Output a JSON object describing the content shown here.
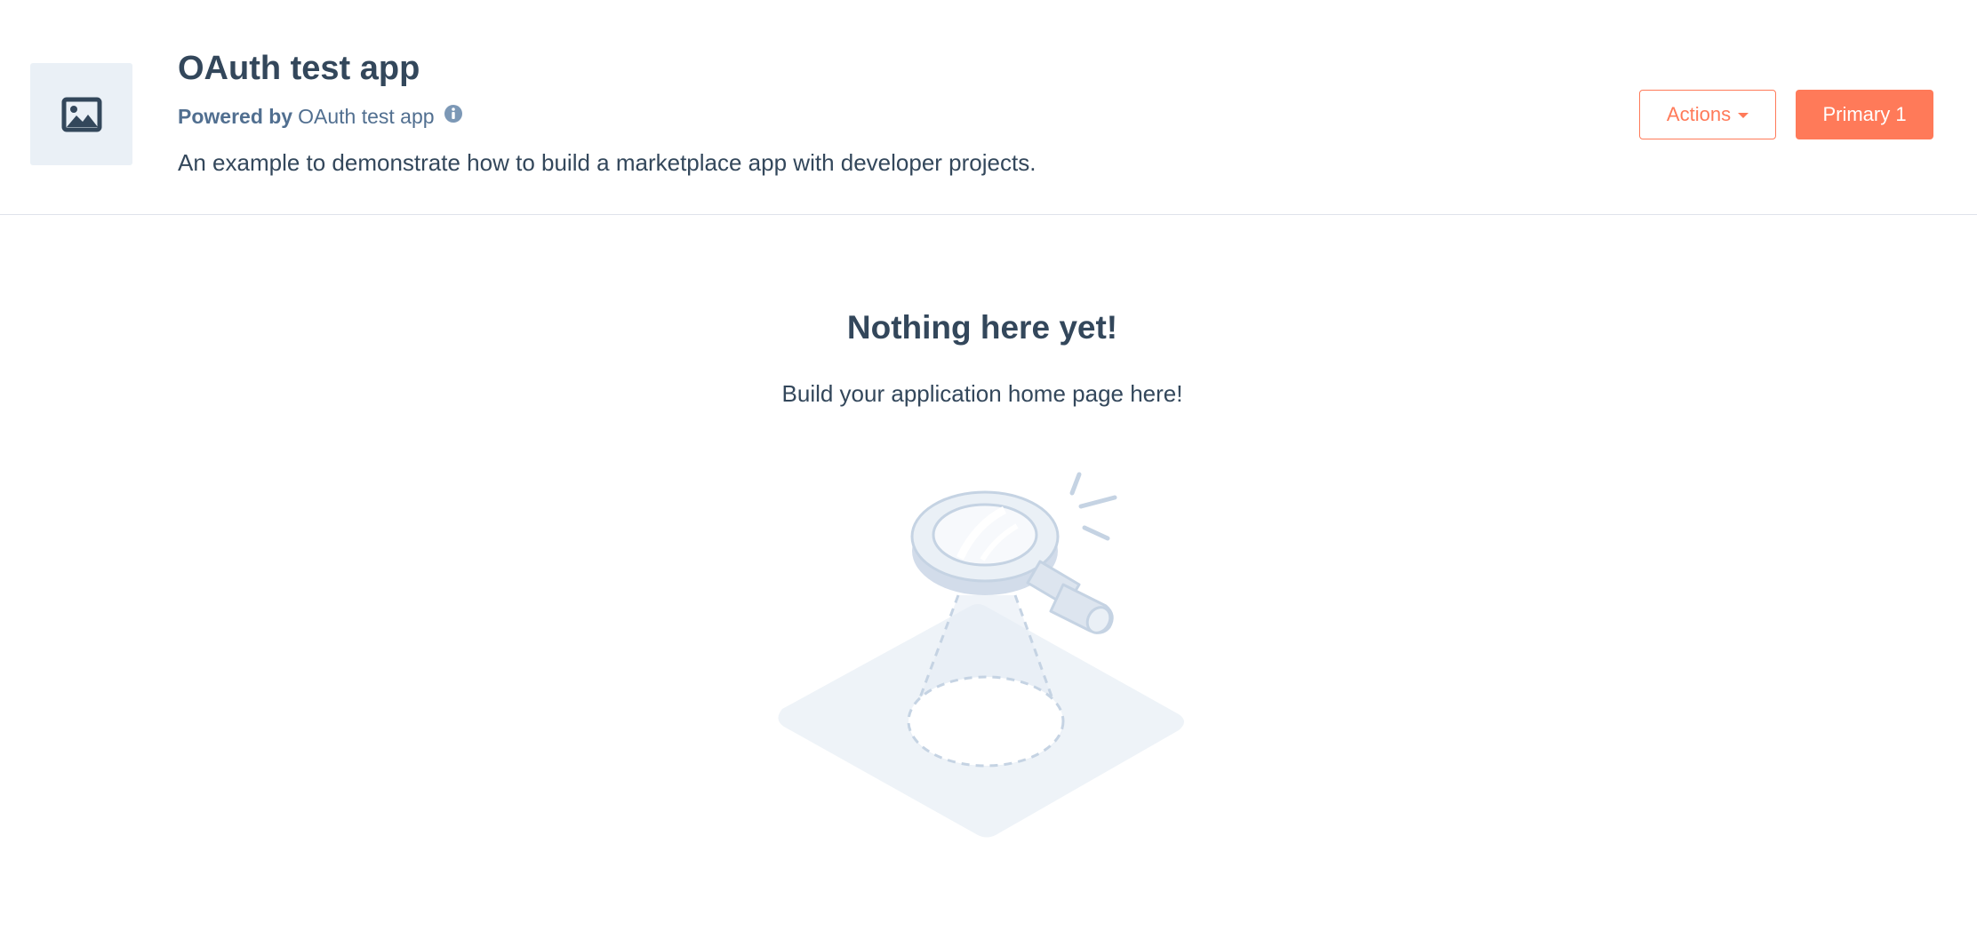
{
  "header": {
    "title": "OAuth test app",
    "powered_by_label": "Powered by",
    "powered_by_name": "OAuth test app",
    "description": "An example to demonstrate how to build a marketplace app with developer projects.",
    "actions_label": "Actions",
    "primary_label": "Primary 1"
  },
  "empty_state": {
    "title": "Nothing here yet!",
    "subtitle": "Build your application home page here!"
  },
  "icons": {
    "app_logo": "image-icon",
    "info": "info-icon",
    "dropdown": "caret-down-icon",
    "illustration": "magnifying-glass-illustration"
  },
  "colors": {
    "accent": "#ff7a59",
    "text": "#33475b",
    "muted": "#516f90",
    "logo_bg": "#eaf0f6",
    "divider": "#dfe3eb"
  }
}
